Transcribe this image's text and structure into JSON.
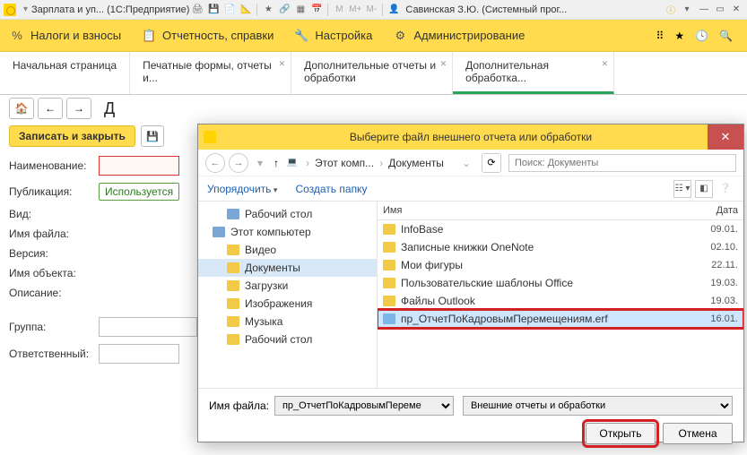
{
  "titlebar": {
    "app_title": "Зарплата и уп... (1С:Предприятие)",
    "user": "Савинская З.Ю. (Системный прог..."
  },
  "main_toolbar": {
    "items": [
      {
        "icon": "percent-icon",
        "label": "Налоги и взносы"
      },
      {
        "icon": "clipboard-icon",
        "label": "Отчетность, справки"
      },
      {
        "icon": "wrench-icon",
        "label": "Настройка"
      },
      {
        "icon": "gear-icon",
        "label": "Администрирование"
      }
    ]
  },
  "tabs": [
    {
      "label": "Начальная страница"
    },
    {
      "label": "Печатные формы, отчеты и..."
    },
    {
      "label": "Дополнительные отчеты и обработки"
    },
    {
      "label": "Дополнительная обработка..."
    }
  ],
  "doc": {
    "heading": "Д",
    "save_close": "Записать и закрыть",
    "fields": {
      "name_label": "Наименование:",
      "pub_label": "Публикация:",
      "pub_value": "Используется",
      "kind_label": "Вид:",
      "filename_label": "Имя файла:",
      "version_label": "Версия:",
      "objname_label": "Имя объекта:",
      "desc_label": "Описание:",
      "group_label": "Группа:",
      "resp_label": "Ответственный:"
    }
  },
  "dialog": {
    "title": "Выберите файл внешнего отчета или обработки",
    "crumb1": "Этот комп...",
    "crumb2": "Документы",
    "search_ph": "Поиск: Документы",
    "organize": "Упорядочить",
    "new_folder": "Создать папку",
    "tree": [
      {
        "label": "Рабочий стол",
        "level": 1,
        "icon": "pc"
      },
      {
        "label": "Этот компьютер",
        "level": 0,
        "icon": "pc"
      },
      {
        "label": "Видео",
        "level": 1,
        "icon": "fi"
      },
      {
        "label": "Документы",
        "level": 1,
        "icon": "fi",
        "sel": true
      },
      {
        "label": "Загрузки",
        "level": 1,
        "icon": "fi"
      },
      {
        "label": "Изображения",
        "level": 1,
        "icon": "fi"
      },
      {
        "label": "Музыка",
        "level": 1,
        "icon": "fi"
      },
      {
        "label": "Рабочий стол",
        "level": 1,
        "icon": "fi"
      }
    ],
    "cols": {
      "name": "Имя",
      "date": "Дата"
    },
    "rows": [
      {
        "name": "InfoBase",
        "date": "09.01.",
        "folder": true
      },
      {
        "name": "Записные книжки OneNote",
        "date": "02.10.",
        "folder": true
      },
      {
        "name": "Мои фигуры",
        "date": "22.11.",
        "folder": true
      },
      {
        "name": "Пользовательские шаблоны Office",
        "date": "19.03.",
        "folder": true
      },
      {
        "name": "Файлы Outlook",
        "date": "19.03.",
        "folder": true
      },
      {
        "name": "пр_ОтчетПоКадровымПеремещениям.erf",
        "date": "16.01.",
        "folder": false,
        "sel": true
      }
    ],
    "filename_label": "Имя файла:",
    "filename_value": "пр_ОтчетПоКадровымПереме",
    "filter": "Внешние отчеты и обработки",
    "open": "Открыть",
    "cancel": "Отмена"
  }
}
